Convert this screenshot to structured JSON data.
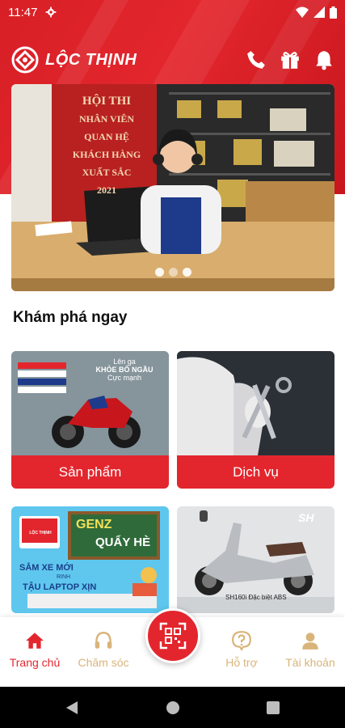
{
  "status_bar": {
    "time": "11:47"
  },
  "brand": {
    "name": "LỘC THỊNH",
    "primary_color": "#e3262d"
  },
  "header_actions": [
    "phone-icon",
    "gift-icon",
    "bell-icon"
  ],
  "banner": {
    "sign_lines": [
      "HỘI THI",
      "NHÂN VIÊN",
      "QUAN HỆ",
      "KHÁCH HÀNG",
      "XUẤT SẮC",
      "2021"
    ],
    "slide_count": 3,
    "active_slide": 1
  },
  "explore": {
    "title": "Khám phá ngay",
    "cards": [
      {
        "label": "Sản phẩm",
        "image_text": [
          "Lên ga",
          "KHỎE BỐ NGẦU",
          "Cực mạnh"
        ]
      },
      {
        "label": "Dịch vụ"
      },
      {
        "image_text": [
          "LỘC THỊNH",
          "GENZ",
          "QUẨY HÈ",
          "SẮM XE MỚI",
          "RINH",
          "TẬU LAPTOP XỊN"
        ]
      },
      {
        "image_text": [
          "SH",
          "SH160i Đặc biệt ABS"
        ]
      }
    ]
  },
  "bottom_nav": {
    "items": [
      {
        "label": "Trang chủ",
        "icon": "home-icon",
        "active": true
      },
      {
        "label": "Chăm sóc",
        "icon": "headset-icon",
        "active": false
      },
      {
        "label": "Hỗ trợ",
        "icon": "help-icon",
        "active": false
      },
      {
        "label": "Tài khoản",
        "icon": "user-icon",
        "active": false
      }
    ],
    "center_icon": "qr-scan-icon"
  }
}
